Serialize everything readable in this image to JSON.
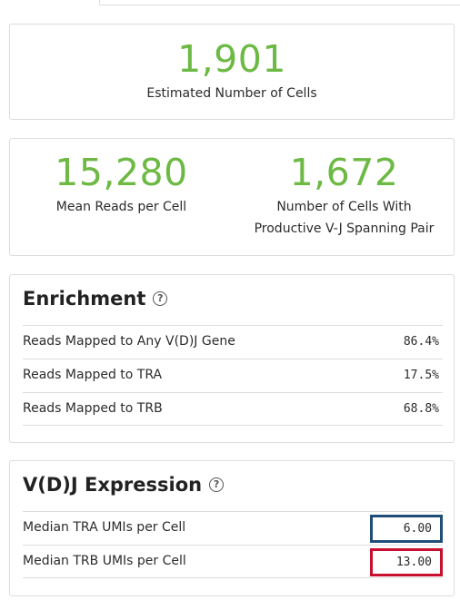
{
  "summary": {
    "estimated_cells_value": "1,901",
    "estimated_cells_label": "Estimated Number of Cells",
    "mean_reads_value": "15,280",
    "mean_reads_label": "Mean Reads per Cell",
    "productive_cells_value": "1,672",
    "productive_cells_label_line1": "Number of Cells With",
    "productive_cells_label_line2": "Productive V-J Spanning Pair"
  },
  "enrichment": {
    "title": "Enrichment",
    "help_icon": "question-circle-icon",
    "rows": [
      {
        "label": "Reads Mapped to Any V(D)J Gene",
        "value": "86.4%"
      },
      {
        "label": "Reads Mapped to TRA",
        "value": "17.5%"
      },
      {
        "label": "Reads Mapped to TRB",
        "value": "68.8%"
      }
    ]
  },
  "vdj_expression": {
    "title": "V(D)J Expression",
    "help_icon": "question-circle-icon",
    "rows": [
      {
        "label": "Median TRA UMIs per Cell",
        "value": "6.00",
        "highlight": "#1f4e79"
      },
      {
        "label": "Median TRB UMIs per Cell",
        "value": "13.00",
        "highlight": "#c8102e"
      }
    ]
  },
  "colors": {
    "metric_green": "#6cb944",
    "highlight_blue": "#1f4e79",
    "highlight_red": "#c8102e"
  }
}
